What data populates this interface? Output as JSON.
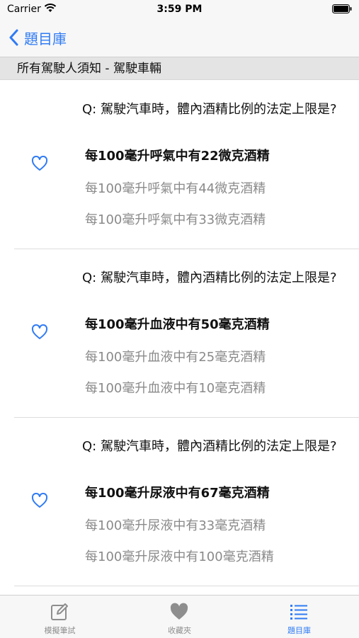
{
  "status_bar": {
    "carrier": "Carrier",
    "time": "3:59 PM"
  },
  "nav": {
    "back_label": "題目庫"
  },
  "section": {
    "title": "所有駕駛人須知 - 駕駛車輛"
  },
  "colors": {
    "accent": "#2f7bf5",
    "wrong_answer": "#8a8a8a"
  },
  "questions": [
    {
      "question": "Q: 駕駛汽車時，體內酒精比例的法定上限是?",
      "answers": [
        "每100毫升呼氣中有22微克酒精",
        "每100毫升呼氣中有44微克酒精",
        "每100毫升呼氣中有33微克酒精"
      ],
      "correct_index": 0,
      "favorite": false
    },
    {
      "question": "Q: 駕駛汽車時，體內酒精比例的法定上限是?",
      "answers": [
        "每100毫升血液中有50毫克酒精",
        "每100毫升血液中有25毫克酒精",
        "每100毫升血液中有10毫克酒精"
      ],
      "correct_index": 0,
      "favorite": false
    },
    {
      "question": "Q: 駕駛汽車時，體內酒精比例的法定上限是?",
      "answers": [
        "每100毫升尿液中有67毫克酒精",
        "每100毫升尿液中有33毫克酒精",
        "每100毫升尿液中有100毫克酒精"
      ],
      "correct_index": 0,
      "favorite": false
    }
  ],
  "tabs": [
    {
      "label": "模擬筆試",
      "icon": "edit-icon",
      "active": false
    },
    {
      "label": "收藏夾",
      "icon": "heart-icon",
      "active": false
    },
    {
      "label": "題目庫",
      "icon": "list-icon",
      "active": true
    }
  ]
}
